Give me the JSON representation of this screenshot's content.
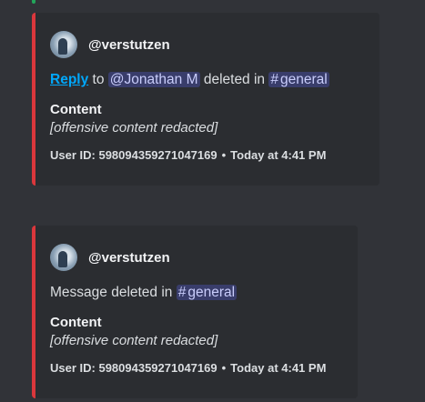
{
  "colors": {
    "background": "#313338",
    "embed_bg": "#2b2d31",
    "embed_accent": "#da373c",
    "link": "#00a8fc",
    "mention_bg": "rgba(88,101,242,0.3)"
  },
  "embeds": [
    {
      "author": "@verstutzen",
      "reply_link": "Reply",
      "to_text": "to",
      "mention_user": "@Jonathan M",
      "deleted_in_text": "deleted in",
      "channel_icon": "#",
      "channel_name": "general",
      "field_name": "Content",
      "field_value": "[offensive content redacted]",
      "user_id": "User ID: 598094359271047169",
      "timestamp": "Today at 4:41 PM"
    },
    {
      "author": "@verstutzen",
      "message_deleted_text": "Message deleted in",
      "channel_icon": "#",
      "channel_name": "general",
      "field_name": "Content",
      "field_value": "[offensive content redacted]",
      "user_id": "User ID: 598094359271047169",
      "timestamp": "Today at 4:41 PM"
    }
  ]
}
